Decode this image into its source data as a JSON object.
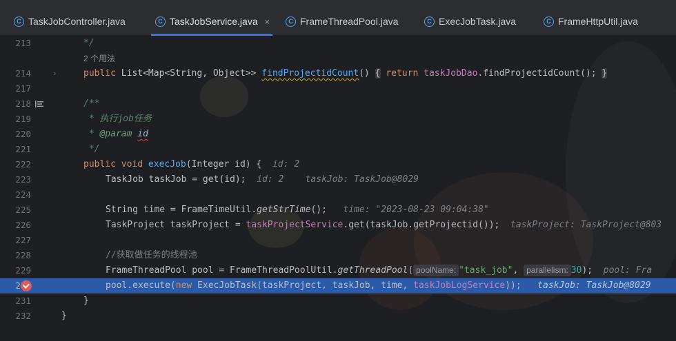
{
  "tabs": [
    {
      "label": "TaskJobController.java",
      "icon": "class-icon",
      "active": false
    },
    {
      "label": "TaskJobService.java",
      "icon": "class-icon",
      "active": true
    },
    {
      "label": "FrameThreadPool.java",
      "icon": "class-icon",
      "active": false
    },
    {
      "label": "ExecJobTask.java",
      "icon": "class-icon",
      "active": false
    },
    {
      "label": "FrameHttpUtil.java",
      "icon": "class-icon",
      "active": false
    }
  ],
  "tab_close_glyph": "×",
  "usages_hint": "2 个用法",
  "lines": {
    "l213": "213",
    "l214": "214",
    "l217": "217",
    "l218": "218",
    "l219": "219",
    "l220": "220",
    "l221": "221",
    "l222": "222",
    "l223": "223",
    "l224": "224",
    "l225": "225",
    "l226": "226",
    "l227": "227",
    "l228": "228",
    "l229": "229",
    "l230": "230",
    "l231": "231",
    "l232": "232"
  },
  "code": {
    "doc_end": "*/",
    "m1_public": "public ",
    "m1_type": "List",
    "m1_generic": "<Map<String, Object>> ",
    "m1_name": "findProjectidCount",
    "m1_paren": "() ",
    "m1_lbrace": "{",
    "m1_return": " return ",
    "m1_field": "taskJobDao",
    "m1_call": ".findProjectidCount(); ",
    "m1_rbrace": "}",
    "doc_open": "/**",
    "doc_line1": " * 执行job任务",
    "doc_param_star": " * ",
    "doc_param_tag": "@param",
    "doc_param_name": "id",
    "doc_close": " */",
    "m2_public": "public void ",
    "m2_name": "execJob",
    "m2_sig": "(Integer id) {",
    "m2_hint": "id: 2",
    "l223_code": "TaskJob taskJob = get(id);",
    "l223_hint1": "id: 2",
    "l223_hint2": "taskJob: TaskJob@8029",
    "l225_a": "String time = FrameTimeUtil.",
    "l225_b": "getStrTime",
    "l225_c": "();",
    "l225_hint": "time: \"2023-08-23 09:04:38\"",
    "l226_a": "TaskProject taskProject = ",
    "l226_field": "taskProjectService",
    "l226_b": ".get(taskJob.getProjectid());",
    "l226_hint": "taskProject: TaskProject@803",
    "l228_comment": "//获取做任务的线程池",
    "l229_a": "FrameThreadPool pool = FrameThreadPoolUtil.",
    "l229_b": "getThreadPool",
    "l229_c": "(",
    "l229_inlay1": "poolName:",
    "l229_str": "\"task_job\"",
    "l229_comma": ", ",
    "l229_inlay2": "parallelism:",
    "l229_num": "30",
    "l229_end": ");",
    "l229_hint": "pool: Fra",
    "l230_a": "pool.execute(",
    "l230_new": "new ",
    "l230_b": "ExecJobTask(taskProject, taskJob, time, ",
    "l230_field": "taskJobLogService",
    "l230_c": "));",
    "l230_hint": "taskJob: TaskJob@8029",
    "l231_code": "}",
    "l232_code": "}"
  },
  "colors": {
    "editor_bg": "#1e1f22",
    "tabbar_bg": "#2b2d30",
    "active_tab_underline": "#3574f0",
    "current_line": "#2a5aa8",
    "breakpoint": "#db5c5c",
    "keyword": "#cf8e6d",
    "function": "#56a8f5",
    "string": "#6aab73",
    "number": "#2aacb8",
    "field": "#c77dbb"
  }
}
